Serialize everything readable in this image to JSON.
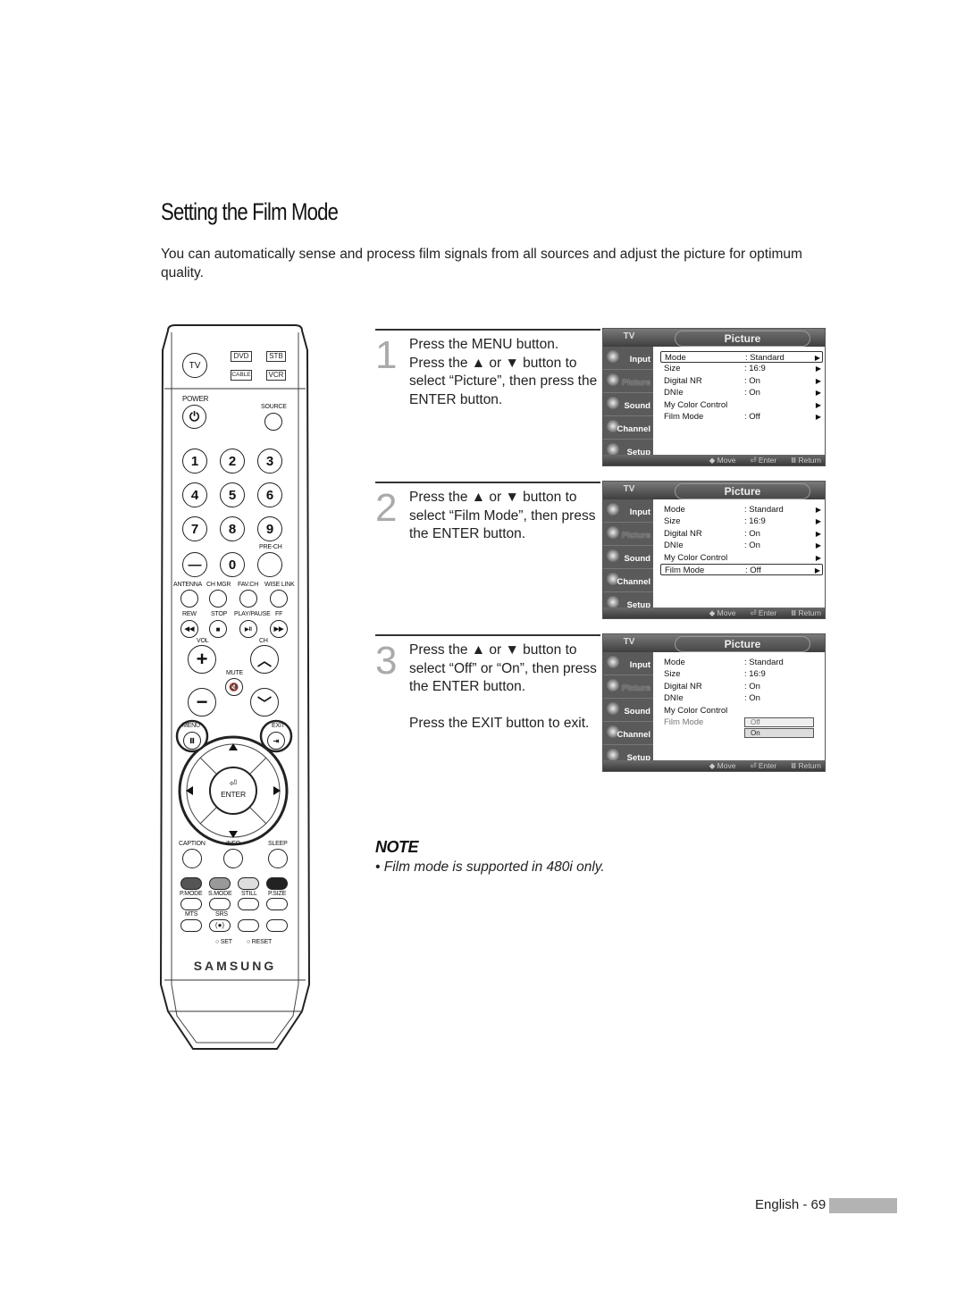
{
  "page": {
    "title": "Setting the Film Mode",
    "intro": "You can automatically sense and process film signals from all sources and adjust the picture for optimum quality."
  },
  "remote": {
    "brand": "SAMSUNG",
    "mode_buttons": {
      "tv": "TV",
      "dvd": "DVD",
      "stb": "STB",
      "cable": "CABLE",
      "vcr": "VCR"
    },
    "power": "POWER",
    "source": "SOURCE",
    "digits": [
      "1",
      "2",
      "3",
      "4",
      "5",
      "6",
      "7",
      "8",
      "9",
      "—",
      "0",
      ""
    ],
    "pre_ch": "PRE-CH",
    "row_labels": [
      "ANTENNA",
      "CH MGR",
      "FAV.CH",
      "WISE LINK"
    ],
    "transport_labels": [
      "REW",
      "STOP",
      "PLAY/PAUSE",
      "FF"
    ],
    "transport_icons": [
      "◀◀",
      "■",
      "▶II",
      "▶▶"
    ],
    "vol": "VOL",
    "ch": "CH",
    "mute": "MUTE",
    "menu": "MENU",
    "exit": "EXIT",
    "enter": "ENTER",
    "func_labels": [
      "CAPTION",
      "INFO",
      "SLEEP"
    ],
    "color_labels": [
      "P.MODE",
      "S.MODE",
      "STILL",
      "P.SIZE"
    ],
    "color_keys": [
      "#555555",
      "#999999",
      "#dddddd",
      "#222222"
    ],
    "mts": "MTS",
    "srs": "SRS",
    "set": "SET",
    "reset": "RESET"
  },
  "steps": [
    {
      "number": "1",
      "lines": [
        "Press the MENU button.",
        "Press the ▲ or ▼ button to select “Picture”, then press the ENTER button."
      ]
    },
    {
      "number": "2",
      "lines": [
        "Press the ▲ or ▼ button to select “Film Mode”, then press the ENTER button."
      ]
    },
    {
      "number": "3",
      "lines": [
        "Press the ▲ or ▼ button to select “Off” or “On”, then press the ENTER button."
      ],
      "extra": "Press the EXIT button to exit."
    }
  ],
  "osd": {
    "tv_label": "TV",
    "title": "Picture",
    "sidebar": [
      "Input",
      "Picture",
      "Sound",
      "Channel",
      "Setup"
    ],
    "nav": {
      "move": "◆ Move",
      "enter": "⏎ Enter",
      "return": "Ⅲ Return"
    },
    "menu": [
      {
        "label": "Mode",
        "value": ": Standard"
      },
      {
        "label": "Size",
        "value": ": 16:9"
      },
      {
        "label": "Digital NR",
        "value": ": On"
      },
      {
        "label": "DNIe",
        "value": ": On"
      },
      {
        "label": "My Color Control",
        "value": ""
      },
      {
        "label": "Film Mode",
        "value": ": Off"
      }
    ],
    "dropdown_options": [
      "Off",
      "On"
    ],
    "arrow": "▶"
  },
  "note": {
    "heading": "NOTE",
    "bullet": "•  Film mode is supported in 480i only."
  },
  "footer": {
    "page_label": "English - 69"
  }
}
